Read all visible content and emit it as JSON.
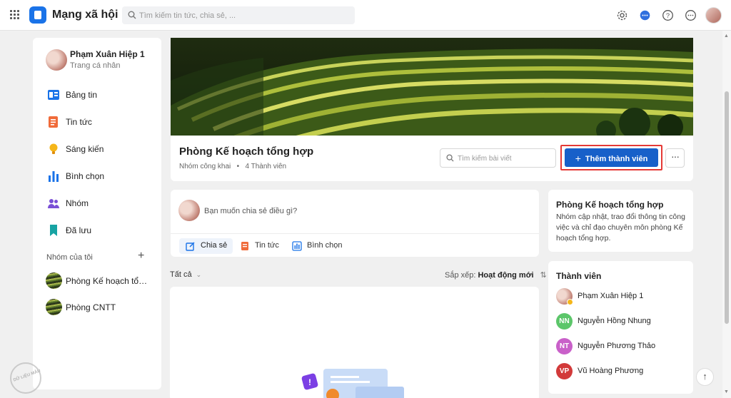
{
  "topbar": {
    "app_name": "Mạng xã hội",
    "search_placeholder": "Tìm kiếm tin tức, chia sẻ, ..."
  },
  "sidebar": {
    "profile_name": "Phạm Xuân Hiệp 1",
    "profile_sub": "Trang cá nhân",
    "items": [
      {
        "label": "Bảng tin",
        "icon": "newsfeed-icon"
      },
      {
        "label": "Tin tức",
        "icon": "news-icon"
      },
      {
        "label": "Sáng kiến",
        "icon": "lightbulb-icon"
      },
      {
        "label": "Bình chọn",
        "icon": "poll-icon"
      },
      {
        "label": "Nhóm",
        "icon": "group-icon"
      },
      {
        "label": "Đã lưu",
        "icon": "bookmark-icon"
      }
    ],
    "my_groups_label": "Nhóm của tôi",
    "groups": [
      "Phòng Kế hoạch tổn...",
      "Phòng CNTT"
    ]
  },
  "watermark": "DỮ LIỆU MẪU",
  "group": {
    "title": "Phòng Kế hoạch tổng hợp",
    "privacy": "Nhóm công khai",
    "member_count": "4 Thành viên",
    "search_placeholder": "Tìm kiếm bài viết",
    "add_member_label": "Thêm thành viên",
    "more_label": "···"
  },
  "composer": {
    "placeholder": "Bạn muốn chia sẻ điều gì?",
    "tabs": [
      "Chia sẻ",
      "Tin tức",
      "Bình chọn"
    ]
  },
  "filter": {
    "all_label": "Tất cả",
    "sort_label": "Sắp xếp:",
    "sort_value": "Hoạt động mới"
  },
  "about": {
    "title": "Phòng Kế hoạch tổng hợp",
    "description": "Nhóm cập nhật, trao đổi thông tin công việc và chỉ đạo chuyên môn phòng Kế hoạch tổng hợp."
  },
  "members": {
    "title": "Thành viên",
    "list": [
      {
        "name": "Phạm Xuân Hiệp 1",
        "initials": "",
        "color": "#c28276"
      },
      {
        "name": "Nguyễn Hồng Nhung",
        "initials": "NN",
        "color": "#5cc66a"
      },
      {
        "name": "Nguyễn Phương Thảo",
        "initials": "NT",
        "color": "#c960c9"
      },
      {
        "name": "Vũ Hoàng Phương",
        "initials": "VP",
        "color": "#d23a3a"
      }
    ]
  },
  "colors": {
    "accent": "#1760c9",
    "highlight_border": "#e53935"
  }
}
